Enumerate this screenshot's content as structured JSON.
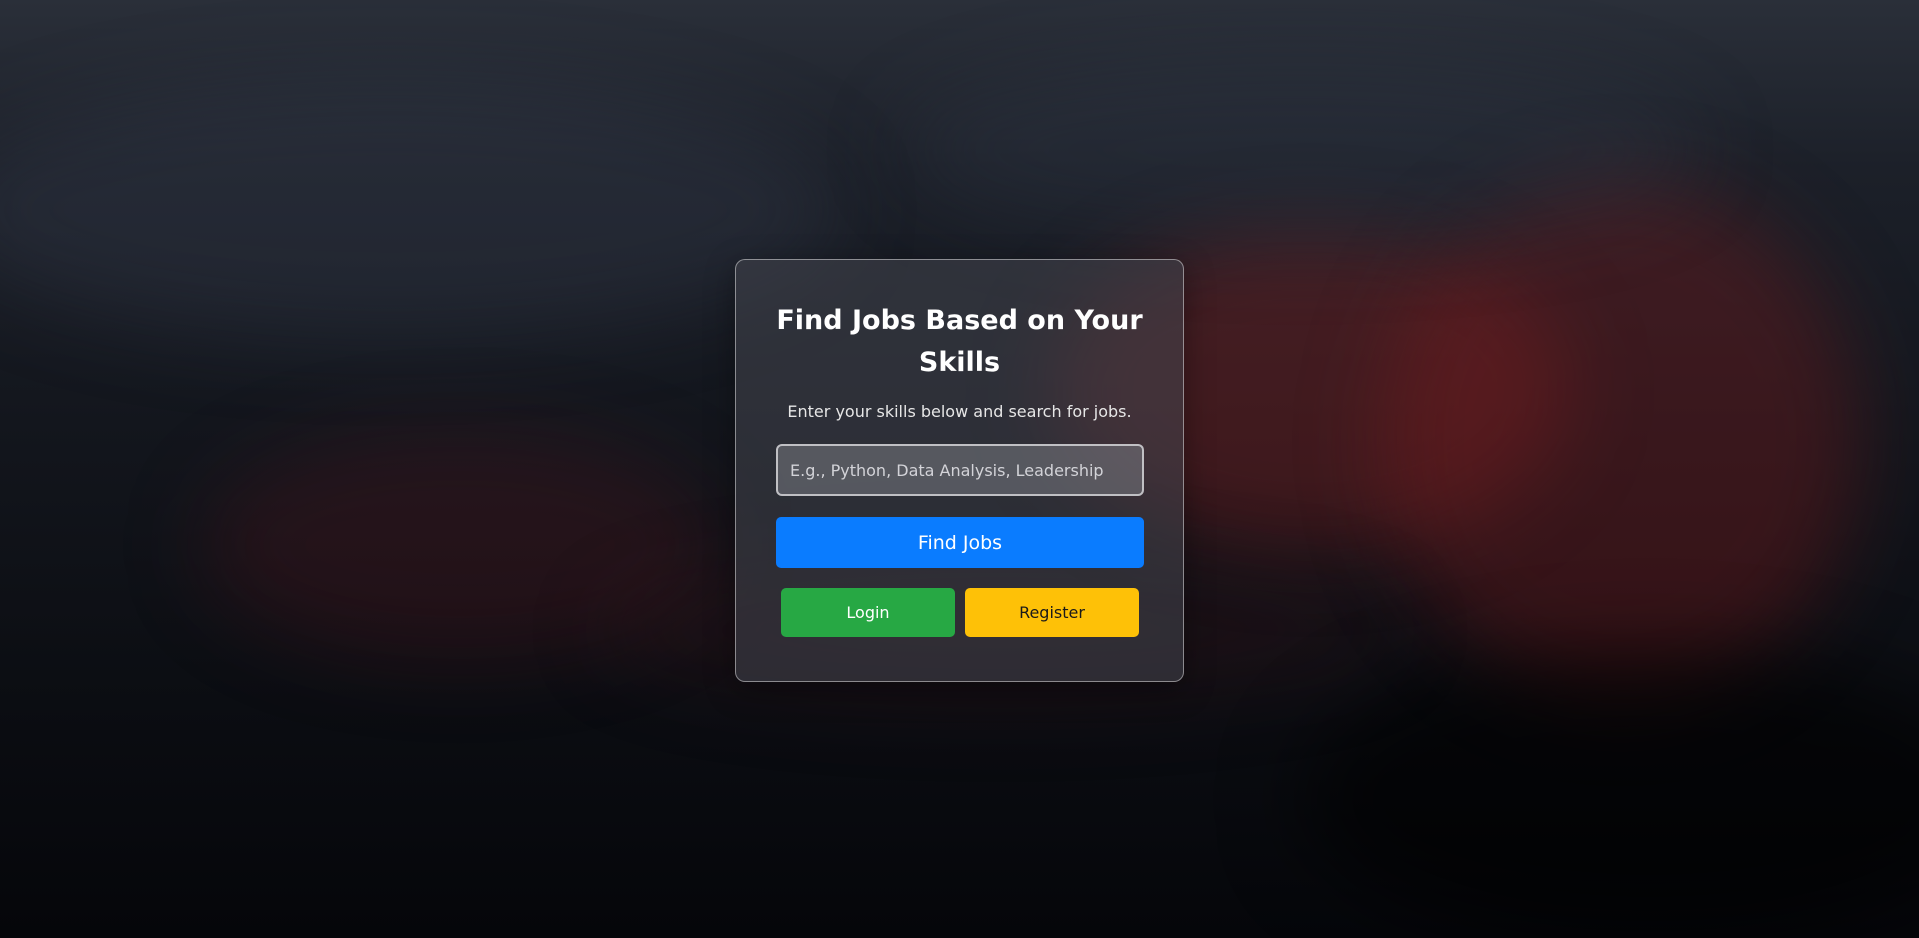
{
  "search_card": {
    "title": "Find Jobs Based on Your Skills",
    "subtitle": "Enter your skills below and search for jobs.",
    "skills_input": {
      "placeholder": "E.g., Python, Data Analysis, Leadership",
      "value": ""
    },
    "find_button_label": "Find Jobs",
    "login_button_label": "Login",
    "register_button_label": "Register"
  },
  "colors": {
    "find_button": "#0a7cff",
    "login_button": "#27a844",
    "register_button": "#fec107",
    "card_border": "#c8c8cc"
  }
}
